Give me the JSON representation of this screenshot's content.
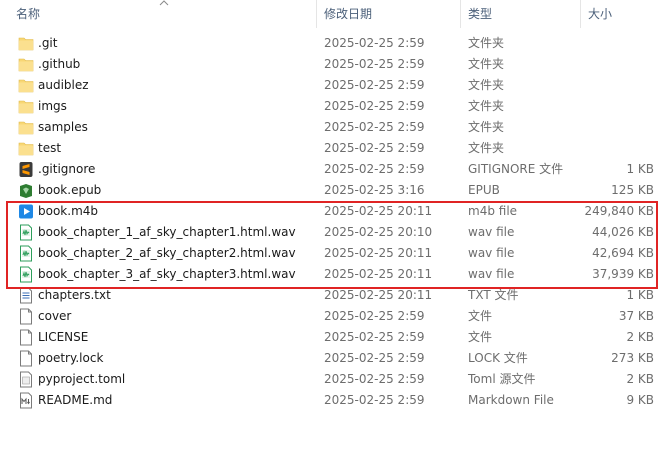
{
  "columns": {
    "name": "名称",
    "modified": "修改日期",
    "type": "类型",
    "size": "大小"
  },
  "files": [
    {
      "name": ".git",
      "modified": "2025-02-25 2:59",
      "type": "文件夹",
      "size": "",
      "icon": "folder-icon"
    },
    {
      "name": ".github",
      "modified": "2025-02-25 2:59",
      "type": "文件夹",
      "size": "",
      "icon": "folder-icon"
    },
    {
      "name": "audiblez",
      "modified": "2025-02-25 2:59",
      "type": "文件夹",
      "size": "",
      "icon": "folder-icon"
    },
    {
      "name": "imgs",
      "modified": "2025-02-25 2:59",
      "type": "文件夹",
      "size": "",
      "icon": "folder-icon"
    },
    {
      "name": "samples",
      "modified": "2025-02-25 2:59",
      "type": "文件夹",
      "size": "",
      "icon": "folder-icon"
    },
    {
      "name": "test",
      "modified": "2025-02-25 2:59",
      "type": "文件夹",
      "size": "",
      "icon": "folder-icon"
    },
    {
      "name": ".gitignore",
      "modified": "2025-02-25 2:59",
      "type": "GITIGNORE 文件",
      "size": "1 KB",
      "icon": "sublime-file-icon"
    },
    {
      "name": "book.epub",
      "modified": "2025-02-25 3:16",
      "type": "EPUB",
      "size": "125 KB",
      "icon": "epub-file-icon"
    },
    {
      "name": "book.m4b",
      "modified": "2025-02-25 20:11",
      "type": "m4b file",
      "size": "249,840 KB",
      "icon": "media-file-icon"
    },
    {
      "name": "book_chapter_1_af_sky_chapter1.html.wav",
      "modified": "2025-02-25 20:10",
      "type": "wav file",
      "size": "44,026 KB",
      "icon": "audio-file-icon"
    },
    {
      "name": "book_chapter_2_af_sky_chapter2.html.wav",
      "modified": "2025-02-25 20:11",
      "type": "wav file",
      "size": "42,694 KB",
      "icon": "audio-file-icon"
    },
    {
      "name": "book_chapter_3_af_sky_chapter3.html.wav",
      "modified": "2025-02-25 20:11",
      "type": "wav file",
      "size": "37,939 KB",
      "icon": "audio-file-icon"
    },
    {
      "name": "chapters.txt",
      "modified": "2025-02-25 20:11",
      "type": "TXT 文件",
      "size": "1 KB",
      "icon": "text-file-icon"
    },
    {
      "name": "cover",
      "modified": "2025-02-25 2:59",
      "type": "文件",
      "size": "37 KB",
      "icon": "generic-file-icon"
    },
    {
      "name": "LICENSE",
      "modified": "2025-02-25 2:59",
      "type": "文件",
      "size": "2 KB",
      "icon": "generic-file-icon"
    },
    {
      "name": "poetry.lock",
      "modified": "2025-02-25 2:59",
      "type": "LOCK 文件",
      "size": "273 KB",
      "icon": "generic-file-icon"
    },
    {
      "name": "pyproject.toml",
      "modified": "2025-02-25 2:59",
      "type": "Toml 源文件",
      "size": "2 KB",
      "icon": "toml-file-icon"
    },
    {
      "name": "README.md",
      "modified": "2025-02-25 2:59",
      "type": "Markdown File",
      "size": "9 KB",
      "icon": "markdown-file-icon"
    }
  ],
  "colors": {
    "folder": "#f8d775",
    "highlight": "#e02424",
    "header_text": "#4c607a",
    "meta_text": "#6d6d6d"
  }
}
